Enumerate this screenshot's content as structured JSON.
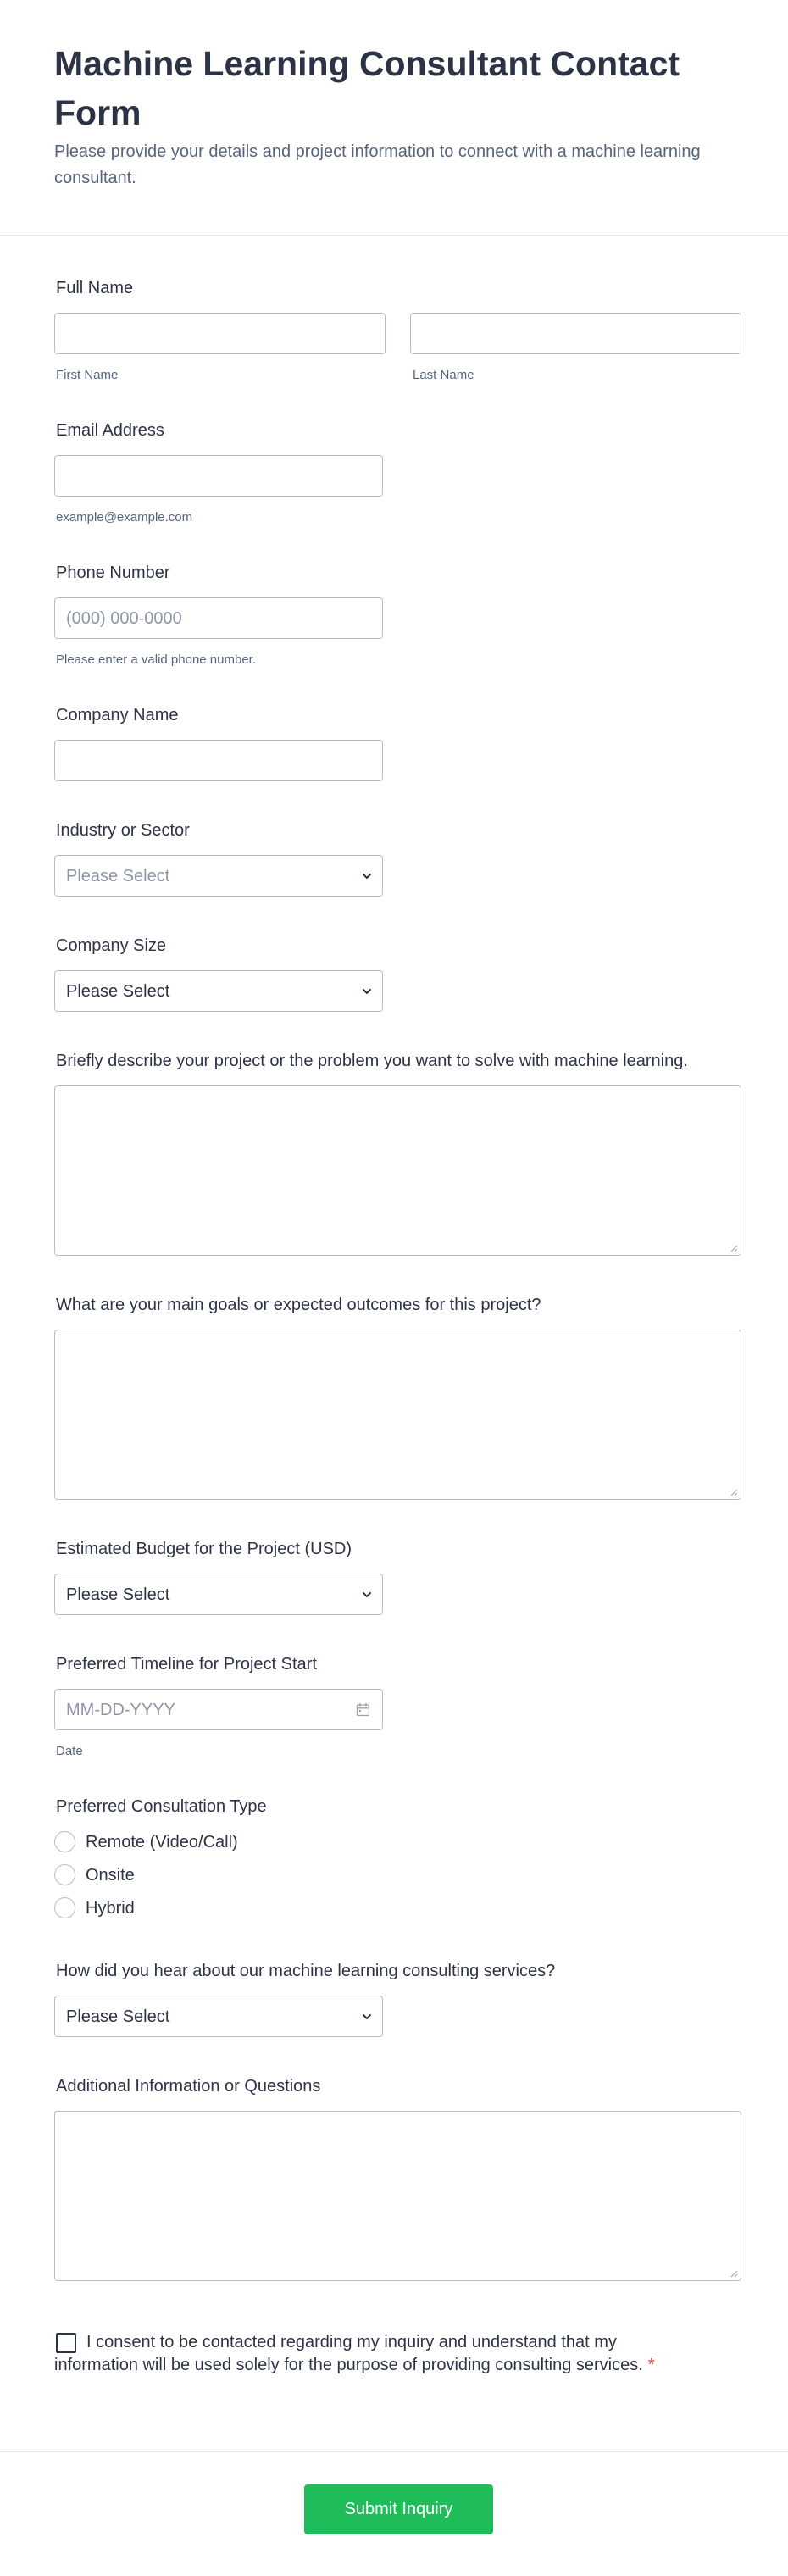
{
  "header": {
    "title": "Machine Learning Consultant Contact Form",
    "subtitle": "Please provide your details and project information to connect with a machine learning consultant."
  },
  "full_name": {
    "label": "Full Name",
    "first_sublabel": "First Name",
    "last_sublabel": "Last Name"
  },
  "email": {
    "label": "Email Address",
    "sublabel": "example@example.com"
  },
  "phone": {
    "label": "Phone Number",
    "placeholder": "(000) 000-0000",
    "sublabel": "Please enter a valid phone number."
  },
  "company": {
    "label": "Company Name"
  },
  "industry": {
    "label": "Industry or Sector",
    "selected": "Please Select"
  },
  "company_size": {
    "label": "Company Size",
    "selected": "Please Select"
  },
  "project_description": {
    "label": "Briefly describe your project or the problem you want to solve with machine learning."
  },
  "goals": {
    "label": "What are your main goals or expected outcomes for this project?"
  },
  "budget": {
    "label": "Estimated Budget for the Project (USD)",
    "selected": "Please Select"
  },
  "timeline": {
    "label": "Preferred Timeline for Project Start",
    "placeholder": "MM-DD-YYYY",
    "sublabel": "Date",
    "icon": "calendar-icon"
  },
  "consultation_type": {
    "label": "Preferred Consultation Type",
    "options": [
      "Remote (Video/Call)",
      "Onsite",
      "Hybrid"
    ]
  },
  "referral": {
    "label": "How did you hear about our machine learning consulting services?",
    "selected": "Please Select"
  },
  "additional_info": {
    "label": "Additional Information or Questions"
  },
  "consent": {
    "text": "I consent to be contacted regarding my inquiry and understand that my information will be used solely for the purpose of providing consulting services.",
    "required_mark": "*"
  },
  "submit": {
    "label": "Submit Inquiry"
  },
  "colors": {
    "accent": "#1fbd59",
    "required": "#e53935",
    "text": "#2c3345",
    "muted": "#57647e"
  }
}
